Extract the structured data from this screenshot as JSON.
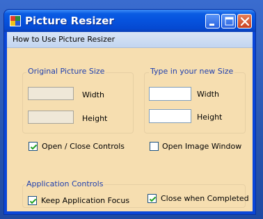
{
  "window": {
    "title": "Picture Resizer"
  },
  "menu": {
    "items": [
      "How to Use Picture Resizer"
    ]
  },
  "original_size": {
    "title": "Original Picture Size",
    "width_label": "Width",
    "height_label": "Height",
    "width_value": "",
    "height_value": ""
  },
  "new_size": {
    "title": "Type in your  new Size",
    "width_label": "Width",
    "height_label": "Height",
    "width_value": "",
    "height_value": ""
  },
  "options": {
    "open_close_controls": {
      "label": "Open / Close Controls",
      "checked": true
    },
    "open_image_window": {
      "label": "Open Image Window",
      "checked": false
    }
  },
  "app_controls": {
    "title": "Application Controls",
    "keep_focus": {
      "label": "Keep Application Focus",
      "checked": true
    },
    "close_when_completed": {
      "label": "Close when Completed",
      "checked": true
    }
  },
  "colors": {
    "title_bar": "#0652dd",
    "client_bg": "#f6deb0",
    "group_title": "#1f3fae",
    "close_button": "#c9401f"
  }
}
